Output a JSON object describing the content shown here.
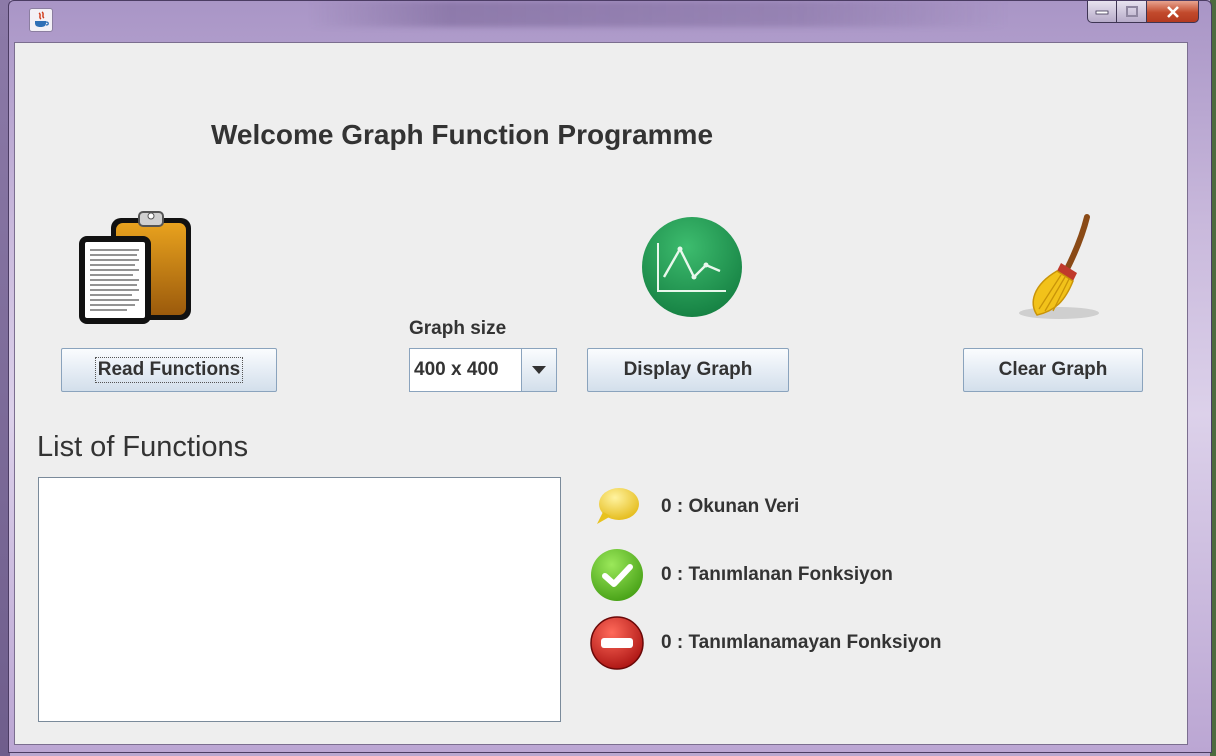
{
  "window": {
    "app_icon": "java-icon"
  },
  "main": {
    "heading": "Welcome Graph Function Programme",
    "read_button": {
      "label": "Read Functions",
      "icon": "clipboard-icon"
    },
    "graph_size": {
      "label": "Graph size",
      "selected": "400 x 400"
    },
    "display_button": {
      "label": "Display Graph",
      "icon": "line-chart-icon"
    },
    "clear_button": {
      "label": "Clear Graph",
      "icon": "broom-icon"
    },
    "list": {
      "title": "List of Functions",
      "items": []
    },
    "stats": [
      {
        "label": "0 : Okunan Veri",
        "icon": "speech-bubble-icon",
        "color": "#f0d23a"
      },
      {
        "label": "0 : Tanımlanan Fonksiyon",
        "icon": "check-circle-icon",
        "color": "#5cbf1e"
      },
      {
        "label": "0 : Tanımlanamayan Fonksiyon",
        "icon": "no-entry-icon",
        "color": "#d01818"
      }
    ]
  }
}
